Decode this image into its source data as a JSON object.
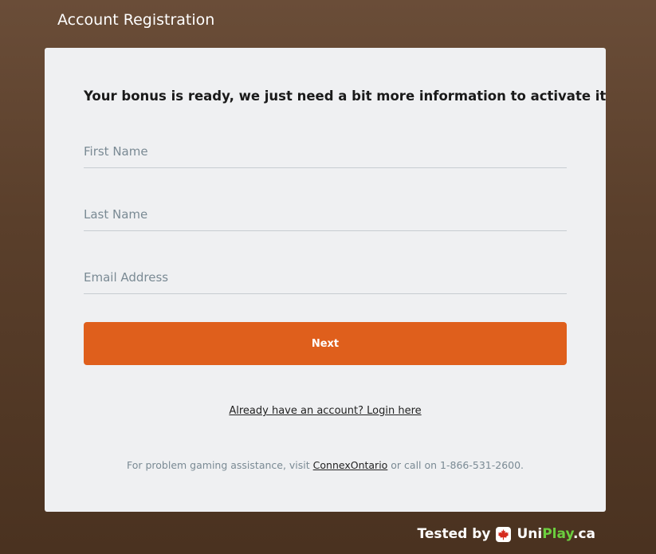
{
  "header": {
    "title": "Account Registration"
  },
  "form": {
    "headline": "Your bonus is ready, we just need a bit more information to activate it",
    "first_name_placeholder": "First Name",
    "last_name_placeholder": "Last Name",
    "email_placeholder": "Email Address",
    "first_name_value": "",
    "last_name_value": "",
    "email_value": "",
    "next_label": "Next",
    "login_link": "Already have an account? Login here"
  },
  "footer": {
    "note_prefix": "For problem gaming assistance, visit ",
    "note_link": "ConnexOntario",
    "note_suffix": " or call on 1-866-531-2600."
  },
  "badge": {
    "tested_by": "Tested by",
    "brand_uni": "Uni",
    "brand_play": "Play",
    "brand_tld": ".ca",
    "icon": "maple-leaf-icon"
  },
  "colors": {
    "accent": "#df5f1c",
    "background": "#5a3f2b",
    "card": "#eff0f2",
    "brand_green": "#6ccf3f"
  }
}
